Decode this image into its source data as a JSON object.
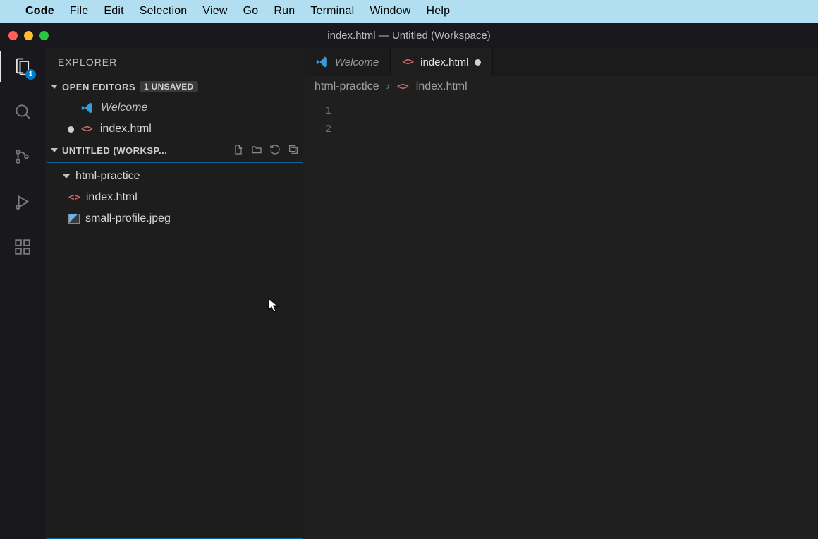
{
  "mac_menu": {
    "app": "Code",
    "items": [
      "File",
      "Edit",
      "Selection",
      "View",
      "Go",
      "Run",
      "Terminal",
      "Window",
      "Help"
    ]
  },
  "window": {
    "title": "index.html — Untitled (Workspace)"
  },
  "activitybar": {
    "badge": "1"
  },
  "sidebar": {
    "title": "EXPLORER",
    "open_editors": {
      "label": "OPEN EDITORS",
      "badge": "1 UNSAVED",
      "items": [
        {
          "label": "Welcome",
          "icon": "vscode",
          "italic": true,
          "unsaved": false
        },
        {
          "label": "index.html",
          "icon": "html",
          "italic": false,
          "unsaved": true
        }
      ]
    },
    "workspace": {
      "label": "UNTITLED (WORKSP...",
      "folders": [
        {
          "label": "html-practice",
          "expanded": true
        }
      ],
      "files": [
        {
          "label": "index.html",
          "icon": "html"
        },
        {
          "label": "small-profile.jpeg",
          "icon": "image"
        }
      ]
    }
  },
  "tabs": [
    {
      "label": "Welcome",
      "icon": "vscode",
      "italic": true,
      "active": false,
      "modified": false
    },
    {
      "label": "index.html",
      "icon": "html",
      "italic": false,
      "active": true,
      "modified": true
    }
  ],
  "breadcrumbs": {
    "segments": [
      "html-practice",
      "index.html"
    ]
  },
  "editor": {
    "line_numbers": [
      "1",
      "2"
    ]
  }
}
